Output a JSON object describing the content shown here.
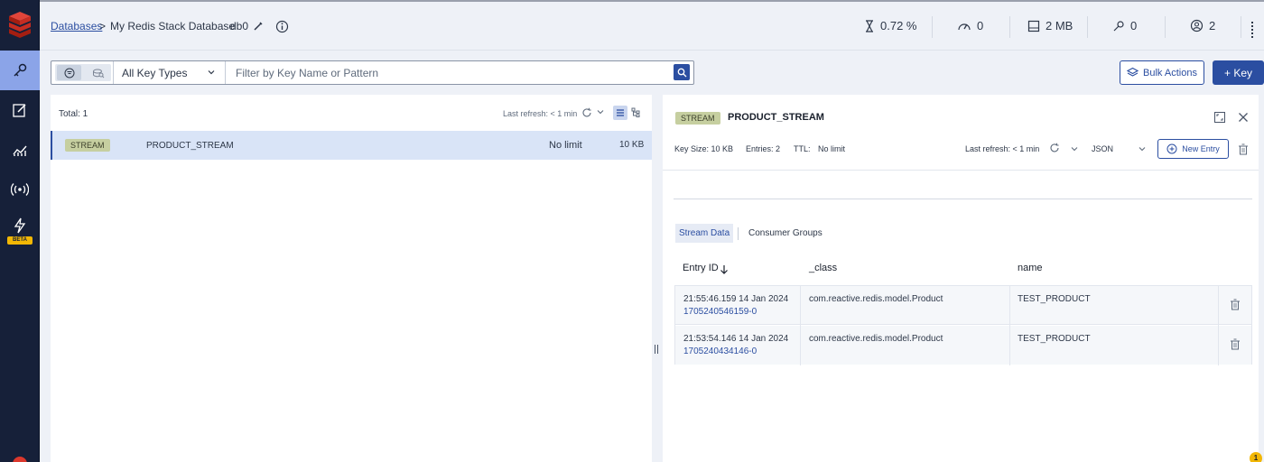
{
  "header": {
    "breadcrumb_databases": "Databases",
    "breadcrumb_sep": ">",
    "database_name": "My Redis Stack Database",
    "db_index": "db0",
    "stats": {
      "cpu": "0.72 %",
      "ops": "0",
      "memory": "2 MB",
      "keys": "0",
      "clients": "2"
    }
  },
  "sidebar": {
    "beta_label": "BETA"
  },
  "filter": {
    "key_type": "All Key Types",
    "search_placeholder": "Filter by Key Name or Pattern"
  },
  "actions": {
    "bulk_actions": "Bulk Actions",
    "add_key": "+ Key"
  },
  "key_list": {
    "total": "Total: 1",
    "last_refresh": "Last refresh: < 1 min",
    "rows": [
      {
        "type": "STREAM",
        "name": "PRODUCT_STREAM",
        "ttl": "No limit",
        "size": "10 KB"
      }
    ]
  },
  "details": {
    "type": "STREAM",
    "name": "PRODUCT_STREAM",
    "key_size": "Key Size: 10 KB",
    "entries": "Entries: 2",
    "ttl_label": "TTL:",
    "ttl_value": "No limit",
    "last_refresh": "Last refresh: < 1 min",
    "format": "JSON",
    "new_entry": "New Entry",
    "tabs": [
      "Stream Data",
      "Consumer Groups"
    ],
    "columns": [
      "Entry ID",
      "_class",
      "name"
    ],
    "entries_list": [
      {
        "timestamp": "21:55:46.159 14 Jan 2024",
        "id": "1705240546159-0",
        "class": "com.reactive.redis.model.Product",
        "name": "TEST_PRODUCT"
      },
      {
        "timestamp": "21:53:54.146 14 Jan 2024",
        "id": "1705240434146-0",
        "class": "com.reactive.redis.model.Product",
        "name": "TEST_PRODUCT"
      }
    ]
  },
  "notification_count": "1",
  "colors": {
    "sidebar_bg": "#162039",
    "accent": "#2b4ea1",
    "stream_badge": "#c6cfa0",
    "redis_red": "#dc382d"
  }
}
